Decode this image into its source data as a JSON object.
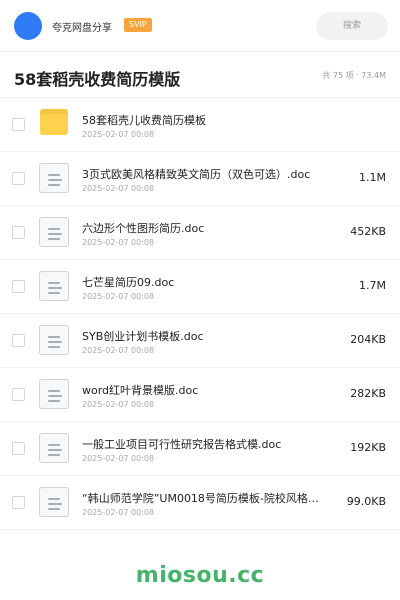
{
  "header": {
    "owner": "夸克网盘分享",
    "badge": "SVIP",
    "search_label": "搜索"
  },
  "share": {
    "title": "58套稻壳收费简历模版",
    "meta": "共 75 项 · 73.4M"
  },
  "files": [
    {
      "type": "folder",
      "name": "58套稻壳儿收费简历模板",
      "date": "2025-02-07 00:08",
      "size": ""
    },
    {
      "type": "doc",
      "name": "3页式欧美风格精致英文简历（双色可选）.doc",
      "date": "2025-02-07 00:08",
      "size": "1.1M"
    },
    {
      "type": "doc",
      "name": "六边形个性图形简历.doc",
      "date": "2025-02-07 00:08",
      "size": "452KB"
    },
    {
      "type": "doc",
      "name": "七芒星简历09.doc",
      "date": "2025-02-07 00:08",
      "size": "1.7M"
    },
    {
      "type": "doc",
      "name": "SYB创业计划书模板.doc",
      "date": "2025-02-07 00:08",
      "size": "204KB"
    },
    {
      "type": "doc",
      "name": "word红叶背景模版.doc",
      "date": "2025-02-07 00:08",
      "size": "282KB"
    },
    {
      "type": "doc",
      "name": "一般工业项目可行性研究报告格式模.doc",
      "date": "2025-02-07 00:08",
      "size": "192KB"
    },
    {
      "type": "doc",
      "name": "“韩山师范学院”UM0018号简历模板-院校风格.…",
      "date": "2025-02-07 00:08",
      "size": "99.0KB"
    }
  ],
  "watermark": "miosou.cc",
  "colors": {
    "avatar": "#2f7bf5",
    "badge": "#f7a43a",
    "folder": "#ffd24d",
    "watermark": "#46b36a"
  },
  "icons": {
    "folder": "folder-icon",
    "doc": "document-icon"
  }
}
